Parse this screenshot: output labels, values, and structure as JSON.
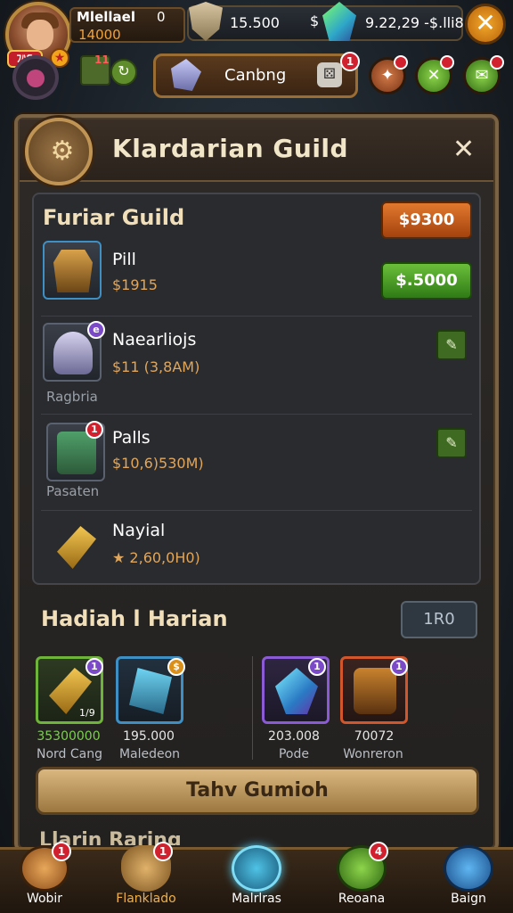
{
  "topbar": {
    "player_name": "Mlellael",
    "player_level": "0",
    "player_sub": "14000",
    "level_badge": "ﾌﾊS",
    "resource_a": "15.500",
    "resource_dollar": "$",
    "resource_b": "9.22,29 -$.lli8",
    "close_glyph": "✕",
    "map_badge": "11",
    "event_label": "Canbng",
    "event_badge": "1"
  },
  "panel": {
    "title": "Klardarian Guild",
    "close_glyph": "✕"
  },
  "guild": {
    "title": "Furiar Guild",
    "price_orange": "$9300",
    "price_green": "$.5000",
    "items": [
      {
        "name": "Pill",
        "cost": "$1915",
        "sub": ""
      },
      {
        "name": "Naearliojs",
        "cost": "$11 (3,8АM)",
        "sub": "Ragbria",
        "badge": "e"
      },
      {
        "name": "Palls",
        "cost": "$10,6)530M)",
        "sub": "Pasaten",
        "badge": "1"
      },
      {
        "name": "Nayial",
        "cost": "★ 2,60,0H0)",
        "sub": ""
      }
    ]
  },
  "daily": {
    "title": "Hadiah l Harian",
    "badge": "1R0",
    "rewards": [
      {
        "value": "35300000",
        "name": "Nord Cang",
        "num": "1/9",
        "badge": "1",
        "color": "#7ad04a"
      },
      {
        "value": "195.000",
        "name": "Maledeon",
        "num": "",
        "badge": "$",
        "color": "#e6e6e6"
      },
      {
        "value": "203.008",
        "name": "Pode",
        "num": "",
        "badge": "1",
        "color": "#e6e6e6"
      },
      {
        "value": "70072",
        "name": "Wonreron",
        "num": "",
        "badge": "1",
        "color": "#e6e6e6"
      }
    ],
    "main_button": "Tahv Gumioh"
  },
  "next_section": "Llarin Raring",
  "nav": [
    {
      "label": "Wobir",
      "badge": "1"
    },
    {
      "label": "Flanklado",
      "badge": "1"
    },
    {
      "label": "Malrlras",
      "badge": ""
    },
    {
      "label": "Reoana",
      "badge": "4"
    },
    {
      "label": "Baign",
      "badge": ""
    }
  ],
  "colors": {
    "accent_orange": "#e1792e",
    "accent_green": "#6bbf3a",
    "frame_gold": "#7a6244",
    "badge_red": "#d1212e"
  }
}
